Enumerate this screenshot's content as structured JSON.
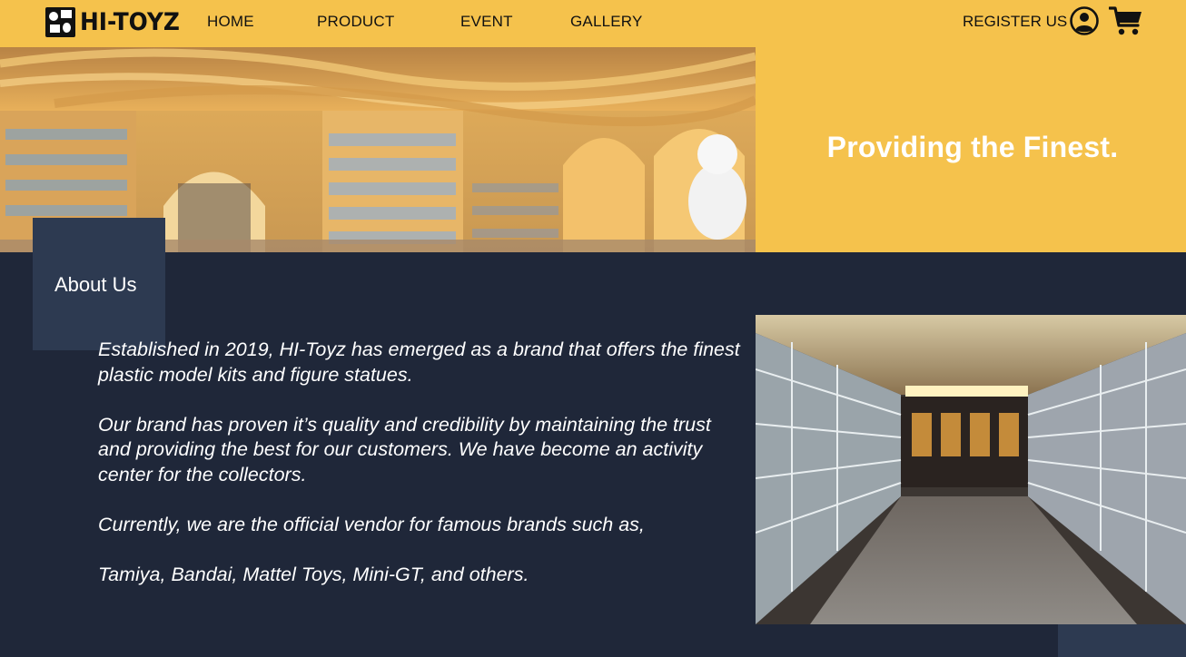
{
  "brand": {
    "name": "HI-TOYZ"
  },
  "nav": {
    "items": [
      {
        "label": "HOME"
      },
      {
        "label": "PRODUCT"
      },
      {
        "label": "EVENT"
      },
      {
        "label": "GALLERY"
      }
    ],
    "register_label": "REGISTER US",
    "user_icon": "user-circle-icon",
    "cart_icon": "shopping-cart-icon"
  },
  "hero": {
    "tagline": "Providing the Finest."
  },
  "about": {
    "heading": "About Us",
    "paragraphs": [
      "Established in 2019, HI-Toyz has emerged as a brand that offers the finest plastic model kits and figure statues.",
      "Our brand has proven it’s quality and credibility by maintaining the trust and providing the best for our customers. We have become an activity center for the collectors.",
      "Currently, we are the official vendor for famous brands such as,",
      "Tamiya, Bandai, Mattel Toys, Mini-GT, and others."
    ]
  },
  "colors": {
    "accent": "#f5c24c",
    "background": "#1f2739",
    "panel": "#2d3a51",
    "text_light": "#ffffff",
    "text_dark": "#111111"
  }
}
